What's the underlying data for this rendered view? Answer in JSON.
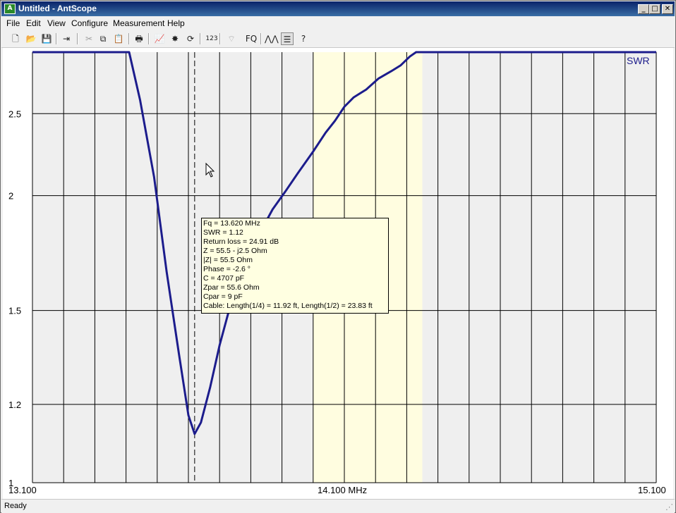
{
  "window": {
    "title": "Untitled - AntScope",
    "app_icon": "antscope-app-icon",
    "controls": {
      "minimize": "_",
      "maximize": "□",
      "close": "✕"
    }
  },
  "menu": [
    "File",
    "Edit",
    "View",
    "Configure",
    "Measurement",
    "Help"
  ],
  "toolbar": [
    {
      "icon": "new-document-icon",
      "glyph": "🗋",
      "enabled": true
    },
    {
      "icon": "open-folder-icon",
      "glyph": "📂",
      "enabled": true
    },
    {
      "icon": "save-icon",
      "glyph": "💾",
      "enabled": true
    },
    {
      "icon": "connect-export-icon",
      "glyph": "⇥",
      "enabled": true
    },
    {
      "icon": "cut-icon",
      "glyph": "✂",
      "enabled": false
    },
    {
      "icon": "copy-icon",
      "glyph": "⧉",
      "enabled": true
    },
    {
      "icon": "paste-icon",
      "glyph": "📋",
      "enabled": false
    },
    {
      "icon": "print-icon",
      "glyph": "🖶",
      "enabled": true
    },
    {
      "icon": "chart-scan-icon",
      "glyph": "📈",
      "enabled": true
    },
    {
      "icon": "continuous-scan-icon",
      "glyph": "✸",
      "enabled": true
    },
    {
      "icon": "refresh-icon",
      "glyph": "⟳",
      "enabled": true
    },
    {
      "icon": "numbers-123-icon",
      "glyph": "123",
      "enabled": true
    },
    {
      "icon": "antenna-signal-icon",
      "glyph": "⌔",
      "enabled": false
    },
    {
      "icon": "frequency-fq-icon",
      "glyph": "FQ",
      "enabled": true
    },
    {
      "icon": "multi-curve-icon",
      "glyph": "⋀⋀",
      "enabled": true
    },
    {
      "icon": "table-toggle-icon",
      "glyph": "☰",
      "enabled": true,
      "pressed": true
    },
    {
      "icon": "help-question-icon",
      "glyph": "?",
      "enabled": true
    }
  ],
  "chart_data": {
    "type": "line",
    "series": [
      {
        "name": "SWR",
        "color": "#1c1c8c",
        "points": [
          [
            13.1,
            3.0
          ],
          [
            13.41,
            3.0
          ],
          [
            13.445,
            2.6
          ],
          [
            13.49,
            2.1
          ],
          [
            13.53,
            1.65
          ],
          [
            13.57,
            1.35
          ],
          [
            13.6,
            1.17
          ],
          [
            13.62,
            1.12
          ],
          [
            13.64,
            1.15
          ],
          [
            13.67,
            1.25
          ],
          [
            13.7,
            1.38
          ],
          [
            13.73,
            1.5
          ],
          [
            13.76,
            1.6
          ],
          [
            13.8,
            1.72
          ],
          [
            13.83,
            1.82
          ],
          [
            13.87,
            1.93
          ],
          [
            13.91,
            2.02
          ],
          [
            13.95,
            2.12
          ],
          [
            14.0,
            2.25
          ],
          [
            14.04,
            2.37
          ],
          [
            14.07,
            2.45
          ],
          [
            14.1,
            2.55
          ],
          [
            14.13,
            2.62
          ],
          [
            14.17,
            2.68
          ],
          [
            14.21,
            2.77
          ],
          [
            14.25,
            2.83
          ],
          [
            14.28,
            2.88
          ],
          [
            14.31,
            2.96
          ],
          [
            14.33,
            3.0
          ],
          [
            15.1,
            3.0
          ]
        ]
      }
    ],
    "x": {
      "min": 13.1,
      "max": 15.1,
      "ticks": [
        "13.100",
        "14.100 MHz",
        "15.100"
      ]
    },
    "y": {
      "min": 1.0,
      "max": 3.0,
      "ticks": [
        {
          "v": 2.5,
          "label": "2.5"
        },
        {
          "v": 2.0,
          "label": "2"
        },
        {
          "v": 1.5,
          "label": "1.5"
        },
        {
          "v": 1.2,
          "label": "1.2"
        },
        {
          "v": 1.0,
          "label": "1"
        }
      ]
    },
    "band_highlight": {
      "from": 14.0,
      "to": 14.35,
      "color": "#fffde0"
    },
    "marker_freq": 13.62,
    "grid": true,
    "legend": "top-right",
    "legend_label": "SWR"
  },
  "tooltip": [
    "Fq = 13.620 MHz",
    "SWR = 1.12",
    "Return loss = 24.91 dB",
    "Z = 55.5 - j2.5 Ohm",
    "|Z| = 55.5 Ohm",
    "Phase = -2.6 °",
    "C = 4707 pF",
    "Zpar = 55.6 Ohm",
    "Cpar = 9 pF",
    "Cable: Length(1/4) = 11.92 ft, Length(1/2) = 23.83 ft"
  ],
  "status": {
    "text": "Ready",
    "grip": "⋰"
  }
}
